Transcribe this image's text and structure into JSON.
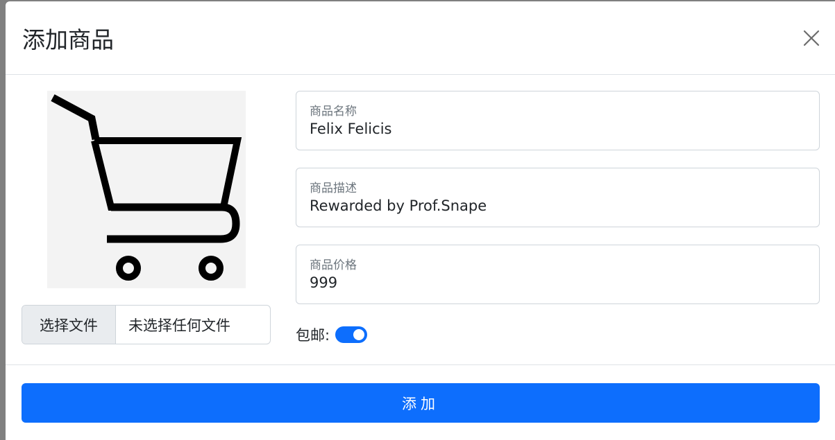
{
  "modal": {
    "title": "添加商品",
    "close_icon": "close-icon"
  },
  "image": {
    "icon": "shopping-cart-icon"
  },
  "file_input": {
    "button_label": "选择文件",
    "status_text": "未选择任何文件"
  },
  "fields": [
    {
      "label": "商品名称",
      "value": "Felix Felicis"
    },
    {
      "label": "商品描述",
      "value": "Rewarded by Prof.Snape"
    },
    {
      "label": "商品价格",
      "value": "999"
    }
  ],
  "free_shipping": {
    "label": "包邮:",
    "checked": true
  },
  "submit": {
    "label": "添加"
  },
  "colors": {
    "primary": "#0d6efd",
    "backdrop": "#808080",
    "border": "#ced4da"
  }
}
